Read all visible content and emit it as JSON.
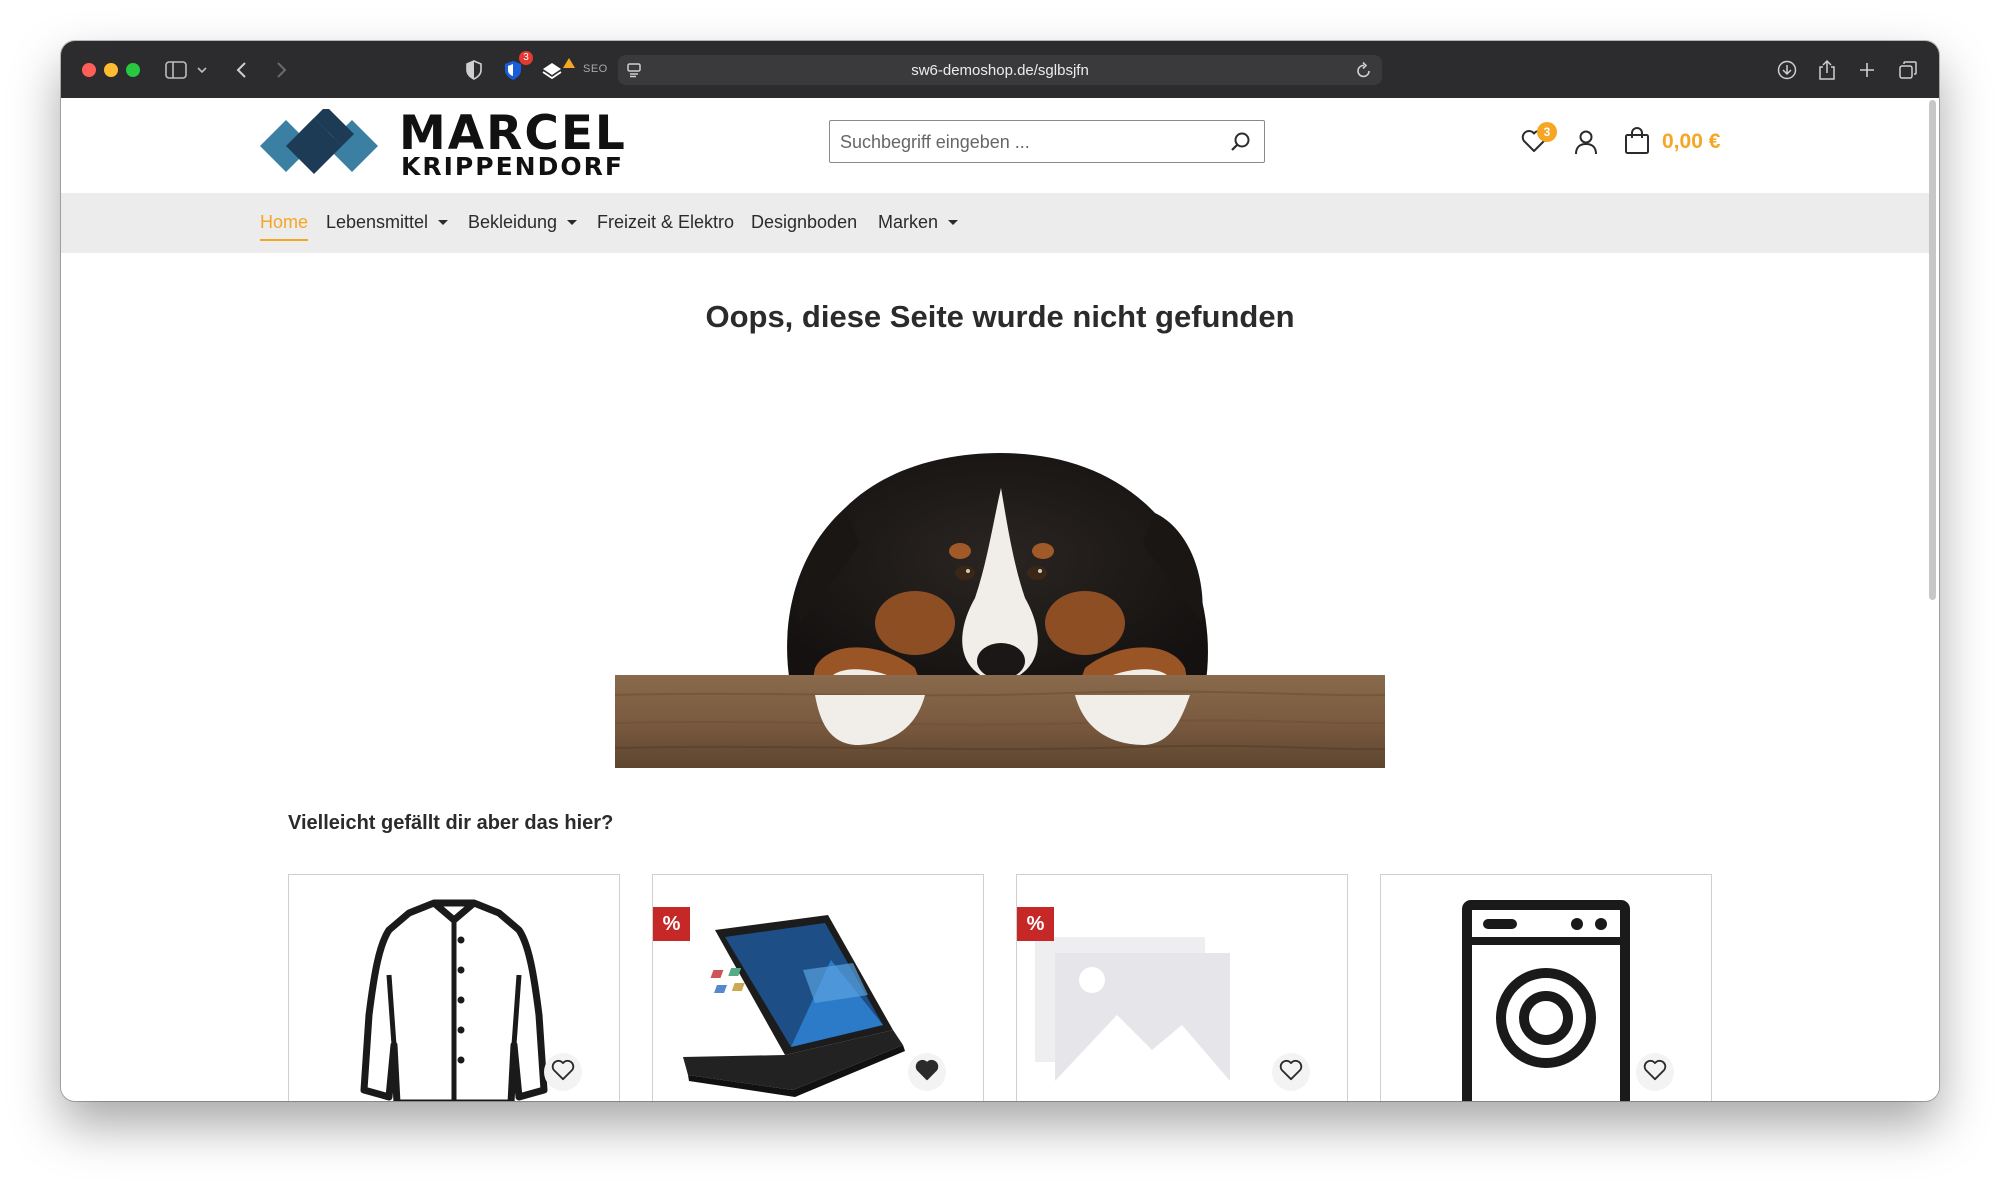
{
  "browser": {
    "url": "sw6-demoshop.de/sglbsjfn",
    "extension_badge": "3",
    "seo_label": "SEO"
  },
  "header": {
    "logo_line1": "MARCEL",
    "logo_line2": "KRIPPENDORF",
    "search_placeholder": "Suchbegriff eingeben ...",
    "wishlist_count": "3",
    "cart_total": "0,00 €",
    "accent_color": "#f5a623"
  },
  "nav": {
    "items": [
      {
        "label": "Home",
        "active": true,
        "dropdown": false
      },
      {
        "label": "Lebensmittel",
        "dropdown": true
      },
      {
        "label": "Bekleidung",
        "dropdown": true
      },
      {
        "label": "Freizeit & Elektro",
        "dropdown": false
      },
      {
        "label": "Designboden",
        "dropdown": false
      },
      {
        "label": "Marken",
        "dropdown": true
      }
    ]
  },
  "main": {
    "title": "Oops, diese Seite wurde nicht gefunden",
    "hero_image": "sad-dog-behind-wooden-board",
    "subtitle": "Vielleicht gefällt dir aber das hier?"
  },
  "products": [
    {
      "image": "shirt-icon",
      "sale": false,
      "wishlisted": false
    },
    {
      "image": "laptop-photo",
      "sale": true,
      "sale_label": "%",
      "wishlisted": true
    },
    {
      "image": "placeholder-image-icon",
      "sale": true,
      "sale_label": "%",
      "wishlisted": false
    },
    {
      "image": "washing-machine-icon",
      "sale": false,
      "wishlisted": false
    }
  ]
}
